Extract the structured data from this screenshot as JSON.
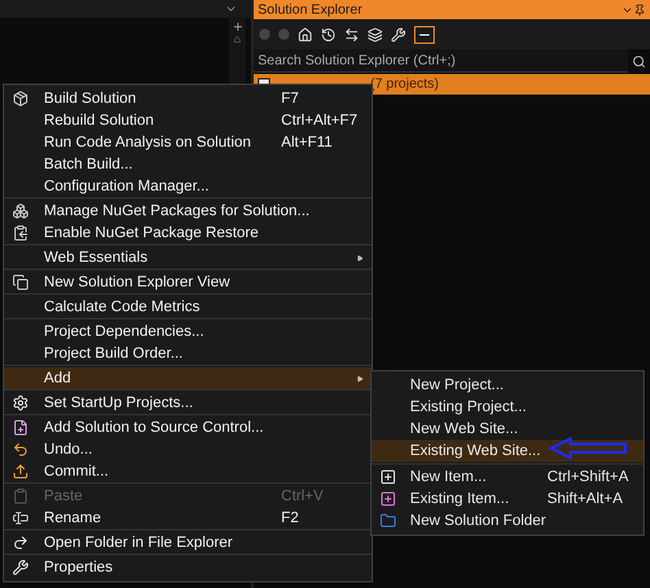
{
  "solution_explorer": {
    "title": "Solution Explorer",
    "search": {
      "placeholder": "Search Solution Explorer (Ctrl+;)"
    },
    "solution_row": {
      "label": "(7 projects)",
      "selected": true
    }
  },
  "context_menu": {
    "groups": [
      [
        {
          "label": "Build Solution",
          "shortcut": "F7",
          "has_submenu": false,
          "selected": false,
          "disabled": false
        },
        {
          "label": "Rebuild Solution",
          "shortcut": "Ctrl+Alt+F7",
          "has_submenu": false,
          "selected": false,
          "disabled": false
        },
        {
          "label": "Run Code Analysis on Solution",
          "shortcut": "Alt+F11",
          "has_submenu": false,
          "selected": false,
          "disabled": false
        },
        {
          "label": "Batch Build...",
          "has_submenu": false,
          "selected": false,
          "disabled": false
        },
        {
          "label": "Configuration Manager...",
          "has_submenu": false,
          "selected": false,
          "disabled": false
        }
      ],
      [
        {
          "label": "Manage NuGet Packages for Solution...",
          "has_submenu": false,
          "selected": false,
          "disabled": false
        },
        {
          "label": "Enable NuGet Package Restore",
          "has_submenu": false,
          "selected": false,
          "disabled": false
        }
      ],
      [
        {
          "label": "Web Essentials",
          "has_submenu": true,
          "selected": false,
          "disabled": false
        }
      ],
      [
        {
          "label": "New Solution Explorer View",
          "has_submenu": false,
          "selected": false,
          "disabled": false
        }
      ],
      [
        {
          "label": "Calculate Code Metrics",
          "has_submenu": false,
          "selected": false,
          "disabled": false
        }
      ],
      [
        {
          "label": "Project Dependencies...",
          "has_submenu": false,
          "selected": false,
          "disabled": false
        },
        {
          "label": "Project Build Order...",
          "has_submenu": false,
          "selected": false,
          "disabled": false
        }
      ],
      [
        {
          "label": "Add",
          "has_submenu": true,
          "selected": true,
          "disabled": false
        }
      ],
      [
        {
          "label": "Set StartUp Projects...",
          "has_submenu": false,
          "selected": false,
          "disabled": false
        }
      ],
      [
        {
          "label": "Add Solution to Source Control...",
          "has_submenu": false,
          "selected": false,
          "disabled": false
        },
        {
          "label": "Undo...",
          "has_submenu": false,
          "selected": false,
          "disabled": false
        },
        {
          "label": "Commit...",
          "has_submenu": false,
          "selected": false,
          "disabled": false
        }
      ],
      [
        {
          "label": "Paste",
          "shortcut": "Ctrl+V",
          "has_submenu": false,
          "selected": false,
          "disabled": true
        },
        {
          "label": "Rename",
          "shortcut": "F2",
          "has_submenu": false,
          "selected": false,
          "disabled": false
        }
      ],
      [
        {
          "label": "Open Folder in File Explorer",
          "has_submenu": false,
          "selected": false,
          "disabled": false
        }
      ],
      [
        {
          "label": "Properties",
          "has_submenu": false,
          "selected": false,
          "disabled": false
        }
      ]
    ]
  },
  "add_submenu": {
    "groups": [
      [
        {
          "label": "New Project...",
          "selected": false
        },
        {
          "label": "Existing Project...",
          "selected": false
        },
        {
          "label": "New Web Site...",
          "selected": false
        },
        {
          "label": "Existing Web Site...",
          "selected": true
        }
      ],
      [
        {
          "label": "New Item...",
          "shortcut": "Ctrl+Shift+A",
          "selected": false
        },
        {
          "label": "Existing Item...",
          "shortcut": "Shift+Alt+A",
          "selected": false
        },
        {
          "label": "New Solution Folder",
          "selected": false
        }
      ]
    ]
  }
}
